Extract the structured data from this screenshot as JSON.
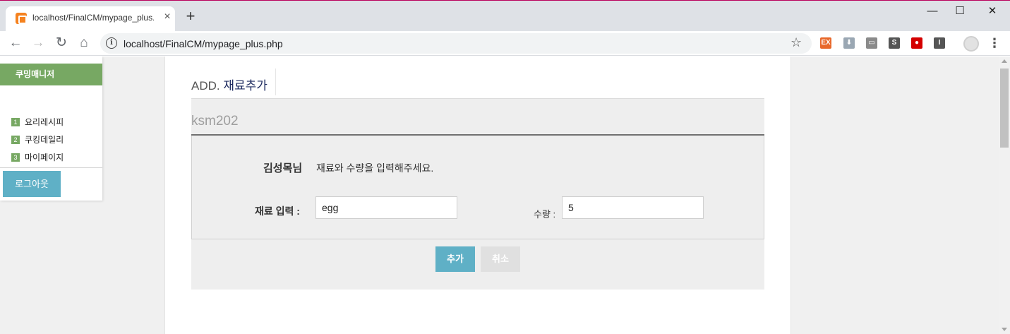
{
  "browser": {
    "tab_title": "localhost/FinalCM/mypage_plus.php",
    "url": "localhost/FinalCM/mypage_plus.php",
    "new_tab_glyph": "+",
    "tab_close_glyph": "×",
    "back_glyph": "←",
    "forward_glyph": "→",
    "reload_glyph": "↻",
    "home_glyph": "⌂",
    "info_glyph": "i",
    "star_glyph": "☆",
    "menu_glyph": "⋮",
    "minimize_glyph": "—",
    "maximize_glyph": "☐",
    "close_glyph": "✕",
    "extensions": [
      {
        "name": "ex-extension-icon",
        "label": "EX",
        "color": "#e8682a"
      },
      {
        "name": "download-extension-icon",
        "label": "⬇",
        "color": "#9aa7b3"
      },
      {
        "name": "card-extension-icon",
        "label": "▭",
        "color": "#8a8a8a"
      },
      {
        "name": "s-extension-icon",
        "label": "S",
        "color": "#555555"
      },
      {
        "name": "stop-extension-icon",
        "label": "●",
        "color": "#d40000"
      },
      {
        "name": "i-extension-icon",
        "label": "I",
        "color": "#555555"
      }
    ]
  },
  "sidebar": {
    "brand": "쿠밍매니저",
    "items": [
      {
        "num": "1",
        "label": "요리레시피"
      },
      {
        "num": "2",
        "label": "쿠킹데일리"
      },
      {
        "num": "3",
        "label": "마이페이지"
      }
    ],
    "logout_label": "로그아웃"
  },
  "main": {
    "header_prefix": "ADD.",
    "header_title": "재료추가",
    "username": "ksm202",
    "greeting_name": "김성목님",
    "greeting_text": "재료와 수량을 입력해주세요.",
    "ingredient_label": "재료 입력 :",
    "ingredient_value": "egg",
    "qty_label": "수량 :",
    "qty_value": "5",
    "add_button": "추가",
    "cancel_button": "취소"
  },
  "colors": {
    "brand_green": "#77a863",
    "accent_blue": "#5fb0c6",
    "title_navy": "#1e2b60"
  }
}
